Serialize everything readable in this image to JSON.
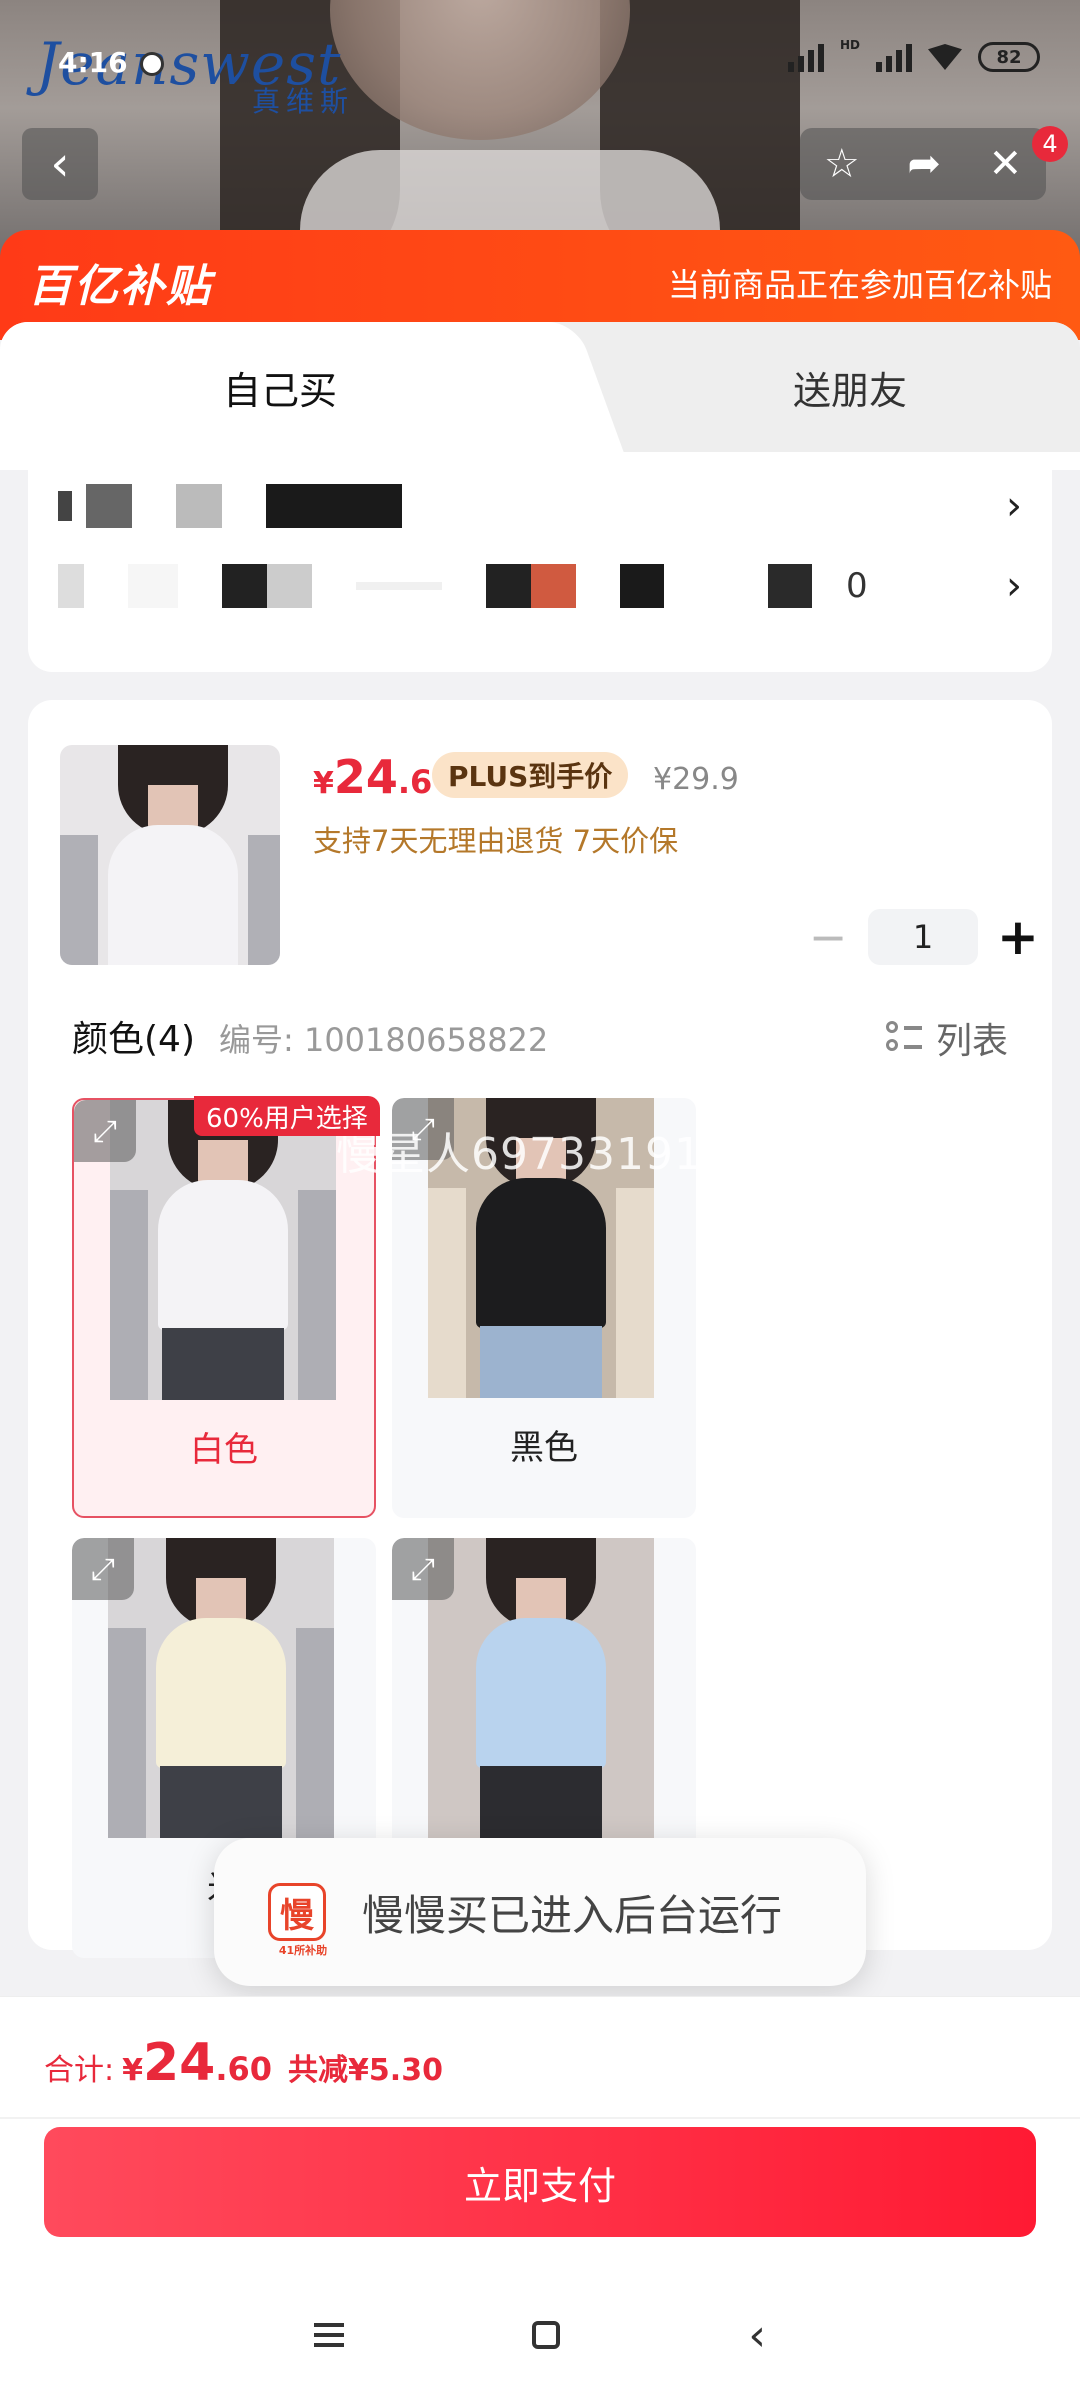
{
  "status_bar": {
    "time": "4:16",
    "battery": "82",
    "network": "HD"
  },
  "backdrop": {
    "brand": "Jeanswest",
    "brand_sub": "真维斯"
  },
  "nav": {
    "back_glyph": "‹",
    "notification_count": "4"
  },
  "subsidy_banner": {
    "brand": "百亿补贴",
    "note": "当前商品正在参加百亿补贴"
  },
  "tabs": [
    {
      "label": "自己买",
      "active": true
    },
    {
      "label": "送朋友",
      "active": false
    }
  ],
  "address": {
    "row2_tail": "0"
  },
  "product": {
    "price_currency": "¥",
    "price_int": "24",
    "price_dec": ".6",
    "plus_tag": "PLUS到手价",
    "original_price": "¥29.9",
    "guarantee": "支持7天无理由退货  7天价保",
    "quantity": "1",
    "color_title": "颜色(4)",
    "code": "编号: 100180658822",
    "list_label": "列表",
    "popular_tag": "60%用户选择",
    "colors": [
      {
        "label": "白色",
        "selected": true,
        "top_color": "#f4f3f6"
      },
      {
        "label": "黑色",
        "selected": false,
        "top_color": "#1c1c1e"
      },
      {
        "label": "米",
        "selected": false,
        "top_color": "#f5efd8"
      },
      {
        "label": "",
        "selected": false,
        "top_color": "#b9d3ee"
      }
    ]
  },
  "watermark": "慢星人69733191X",
  "toast": {
    "icon_char": "慢",
    "icon_sub": "41所补助",
    "message": "慢慢买已进入后台运行"
  },
  "checkout": {
    "total_label": "合计:",
    "total_currency": "¥",
    "total_int": "24",
    "total_dec": ".60",
    "discount": "共减¥5.30",
    "pay_label": "立即支付"
  },
  "colors": {
    "accent": "#e8293b",
    "banner": "#ff4a14",
    "plus_tag_bg": "#fbe3c8"
  }
}
